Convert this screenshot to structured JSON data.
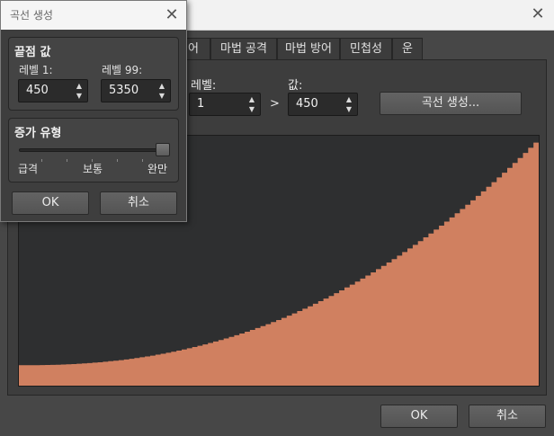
{
  "main": {
    "tabs": [
      "어",
      "마법 공격",
      "마법 방어",
      "민첩성",
      "운"
    ],
    "level_label": "레벨:",
    "level_value": "1",
    "compare_symbol": ">",
    "value_label": "값:",
    "value_value": "450",
    "generate_curve_button": "곡선 생성...",
    "ok_button": "OK",
    "cancel_button": "취소"
  },
  "dialog": {
    "title": "곡선 생성",
    "endpoints_group": "끝점 값",
    "level1_label": "레벨 1:",
    "level1_value": "450",
    "level99_label": "레벨 99:",
    "level99_value": "5350",
    "growth_group": "증가 유형",
    "slider_labels": {
      "left": "급격",
      "middle": "보통",
      "right": "완만"
    },
    "slider_position": 1.0,
    "ok_button": "OK",
    "cancel_button": "취소"
  },
  "colors": {
    "curve_fill": "#d08060",
    "graph_bg": "#2e2f30"
  },
  "chart_data": {
    "type": "area",
    "title": "",
    "xlabel": "",
    "ylabel": "",
    "x_range": [
      1,
      99
    ],
    "start_value": 450,
    "end_value": 5350,
    "growth_type": "완만"
  }
}
